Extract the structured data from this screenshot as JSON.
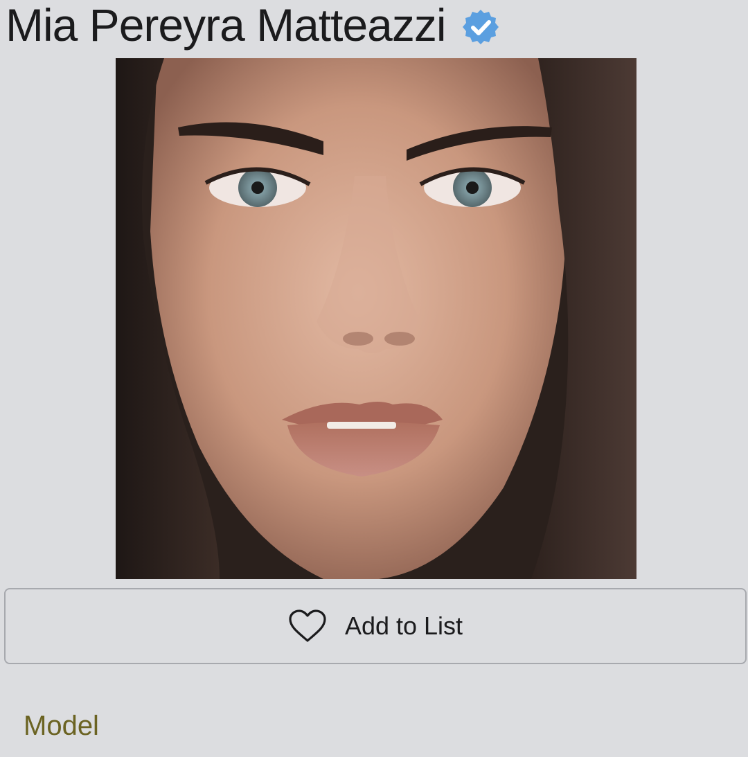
{
  "profile": {
    "name": "Mia Pereyra Matteazzi",
    "verified_icon": "verified-badge-icon",
    "verified_color": "#5b9fe0",
    "photo_icon": "profile-photo",
    "category": "Model",
    "category_color": "#6b6322"
  },
  "actions": {
    "add_to_list_label": "Add to List",
    "add_to_list_icon": "heart-outline-icon"
  }
}
